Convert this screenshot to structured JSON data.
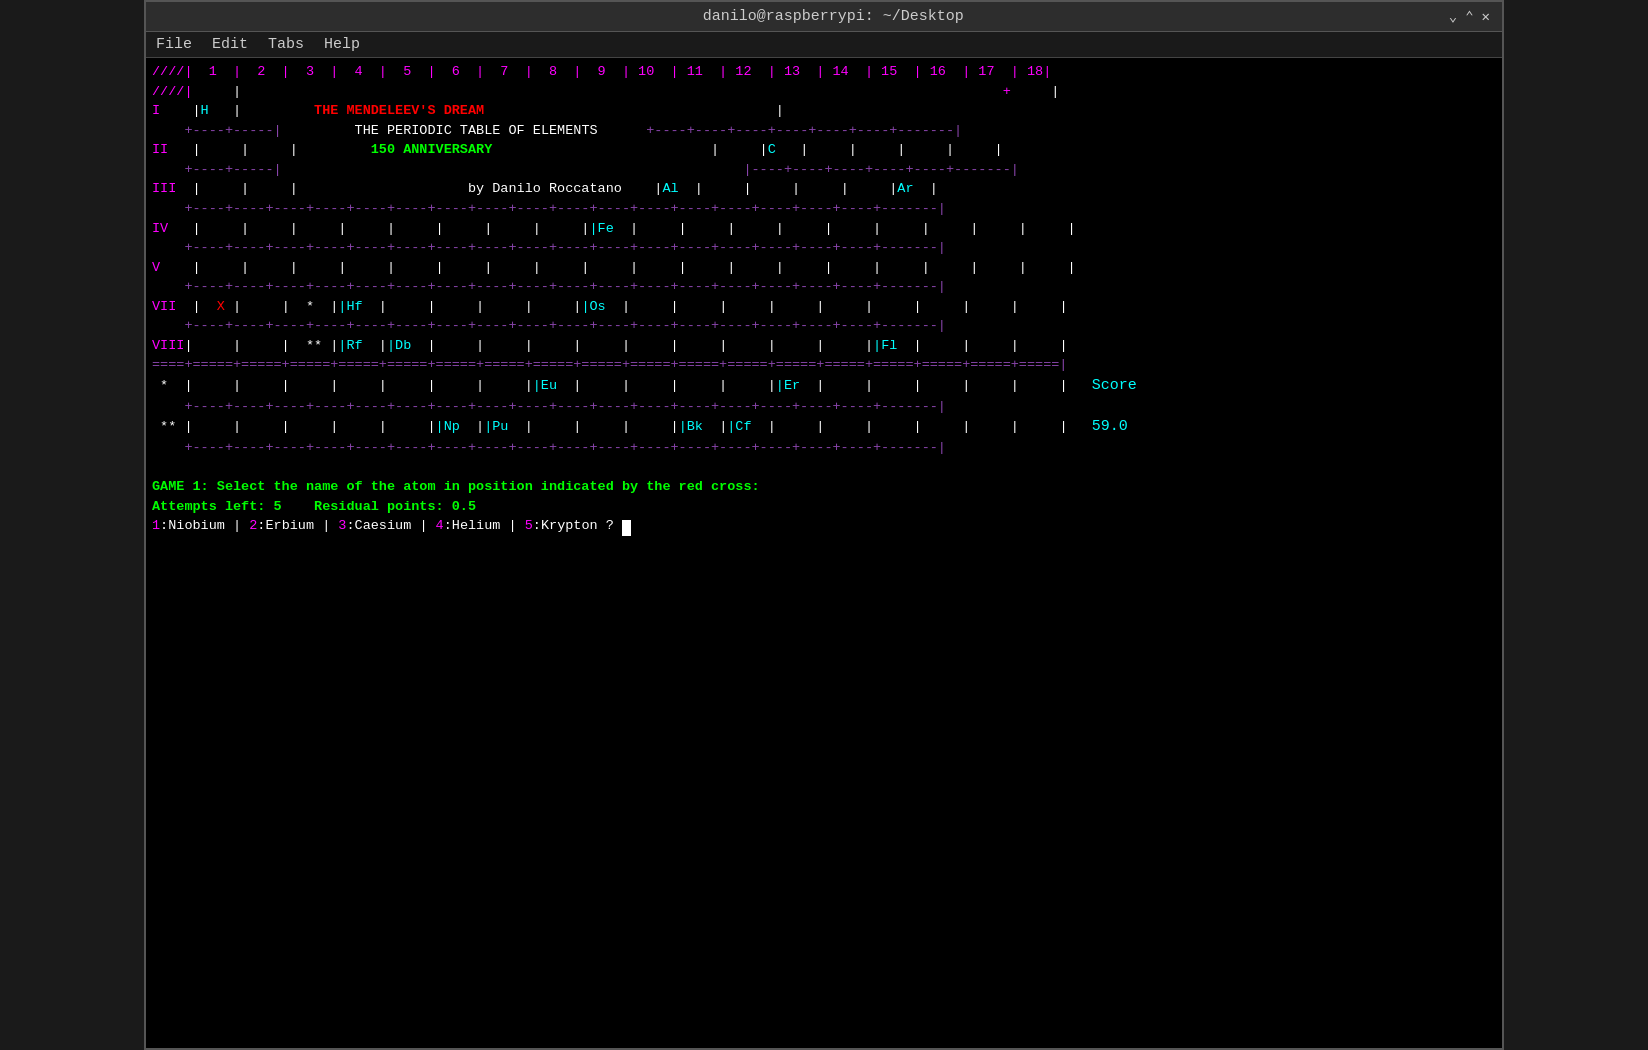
{
  "titlebar": {
    "title": "danilo@raspberrypi: ~/Desktop",
    "btn_minimize": "v",
    "btn_maximize": "^",
    "btn_close": "X"
  },
  "menubar": {
    "items": [
      "File",
      "Edit",
      "Tabs",
      "Help"
    ]
  },
  "terminal": {
    "col_header": "////| 1 | 2 | 3 | 4 | 5 | 6 | 7 | 8 | 9 | 10 | 11 | 12 | 13 | 14 | 15 | 16 | 17 | 18|",
    "title_dream": "THE MENDELEEV'S DREAM",
    "title_table": "THE PERIODIC TABLE OF ELEMENTS",
    "title_anniversary": "150 ANNIVERSARY",
    "author": "by Danilo Roccatano",
    "score_label": "Score",
    "score_value": "59.0",
    "game_line": "GAME 1: Select the name of the atom in position indicated by the red cross:",
    "attempts_line": "Attempts left: 5    Residual points: 0.5",
    "choices": "1:Niobium | 2:Erbium | 3:Caesium | 4:Helium | 5:Krypton ?"
  }
}
